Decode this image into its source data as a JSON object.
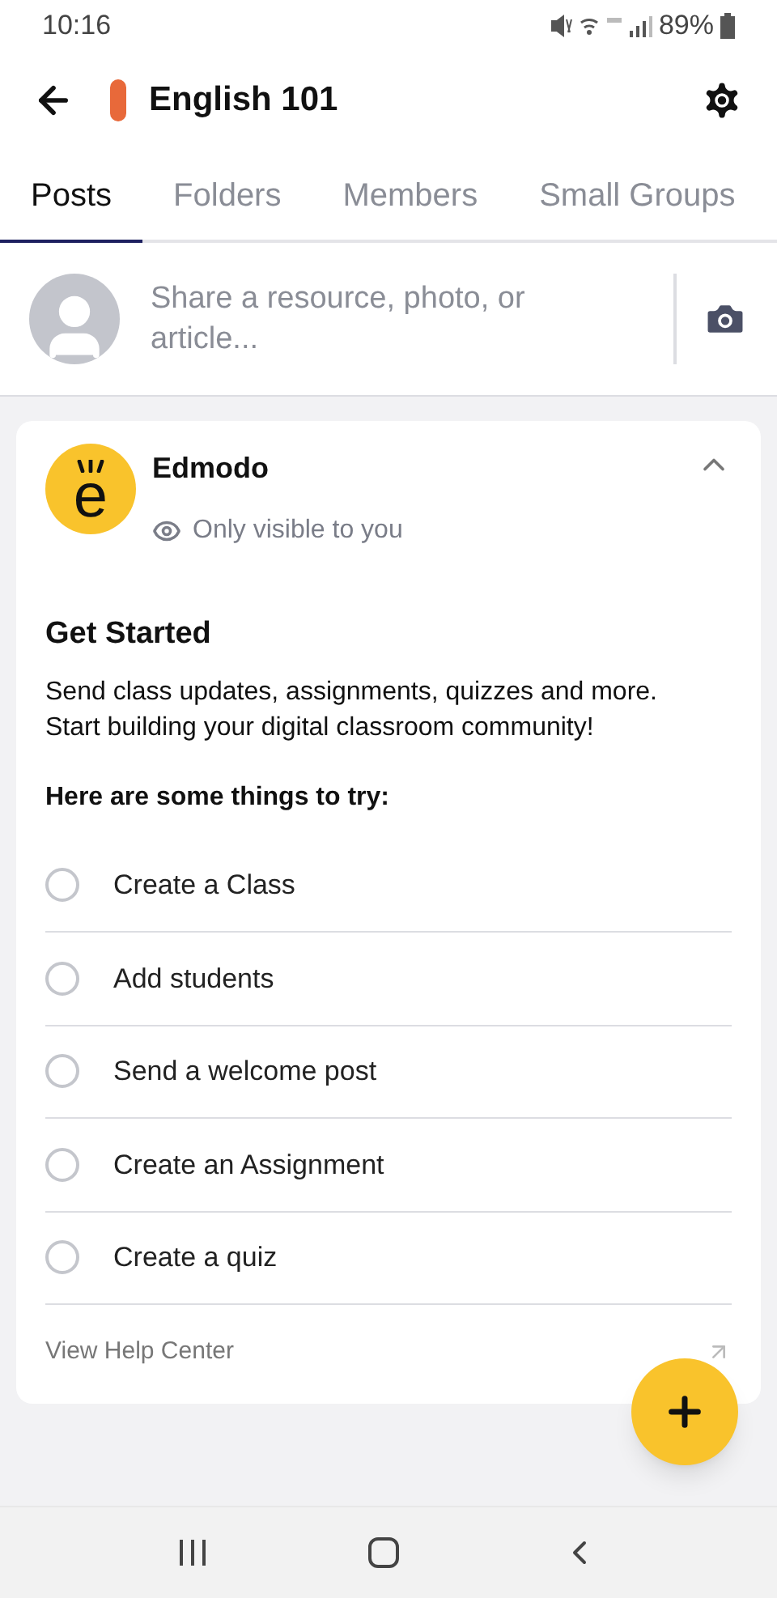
{
  "status_bar": {
    "time": "10:16",
    "battery": "89%"
  },
  "header": {
    "title": "English 101"
  },
  "tabs": [
    {
      "label": "Posts",
      "selected": true
    },
    {
      "label": "Folders",
      "selected": false
    },
    {
      "label": "Members",
      "selected": false
    },
    {
      "label": "Small Groups",
      "selected": false
    }
  ],
  "composer": {
    "placeholder": "Share a resource, photo, or article..."
  },
  "post": {
    "logo_letter": "e",
    "author": "Edmodo",
    "visibility": "Only visible to you",
    "expanded": true,
    "title": "Get Started",
    "body": "Send class updates, assignments, quizzes and more. Start building your digital classroom community!",
    "subtitle": "Here are some things to try:",
    "tasks": [
      {
        "label": "Create a Class",
        "checked": false
      },
      {
        "label": "Add students",
        "checked": false
      },
      {
        "label": "Send a welcome post",
        "checked": false
      },
      {
        "label": "Create an Assignment",
        "checked": false
      },
      {
        "label": "Create a quiz",
        "checked": false
      }
    ],
    "help_link": "View Help Center"
  }
}
